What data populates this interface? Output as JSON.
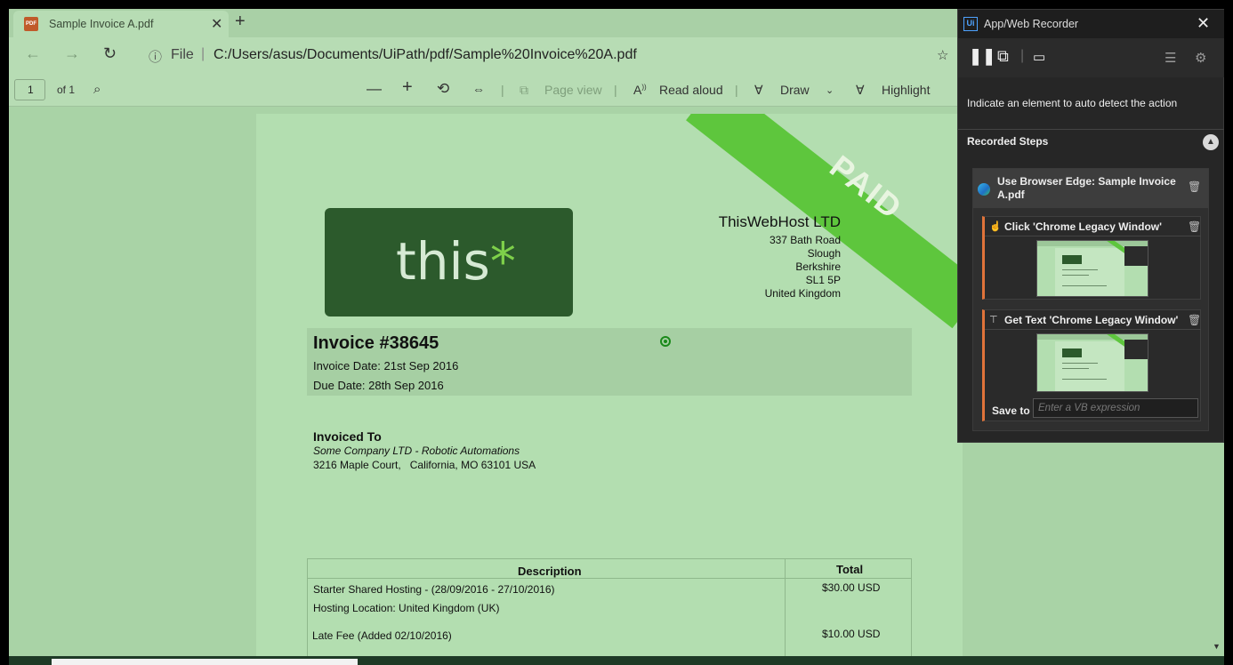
{
  "browser": {
    "tab_title": "Sample Invoice A.pdf",
    "tab_icon": "PDF",
    "file_label": "File",
    "url": "C:/Users/asus/Documents/UiPath/pdf/Sample%20Invoice%20A.pdf"
  },
  "pdf_toolbar": {
    "page_number": "1",
    "page_of": "of 1",
    "page_view": "Page view",
    "read_aloud": "Read aloud",
    "draw": "Draw",
    "highlight": "Highlight"
  },
  "invoice": {
    "paid_stamp": "PAID",
    "logo_text": "this",
    "logo_star": "*",
    "company": {
      "name": "ThisWebHost LTD",
      "line1": "337 Bath Road",
      "line2": "Slough",
      "line3": "Berkshire",
      "line4": "SL1 5P",
      "line5": "United Kingdom"
    },
    "number": "Invoice #38645",
    "invoice_date": "Invoice Date: 21st Sep 2016",
    "due_date": "Due Date: 28th Sep 2016",
    "invoiced_to": {
      "heading": "Invoiced To",
      "company": "Some Company LTD - Robotic Automations",
      "address": "3216 Maple Court,   California, MO 63101 USA"
    },
    "table": {
      "col_description": "Description",
      "col_total": "Total",
      "rows": [
        {
          "description": "Starter Shared Hosting - (28/09/2016 - 27/10/2016)",
          "total": "$30.00 USD"
        },
        {
          "description": "Hosting Location: United Kingdom (UK)",
          "total": ""
        },
        {
          "description": "Late Fee (Added 02/10/2016)",
          "total": "$10.00 USD"
        }
      ]
    }
  },
  "recorder": {
    "title": "App/Web Recorder",
    "hint": "Indicate an element to auto detect the action",
    "recorded_steps_label": "Recorded Steps",
    "steps": {
      "main_title": "Use Browser Edge: Sample Invoice A.pdf",
      "step1": "Click 'Chrome Legacy Window'",
      "step2": "Get Text 'Chrome Legacy Window'",
      "save_to_label": "Save to",
      "save_to_placeholder": "Enter a VB expression"
    }
  },
  "colors": {
    "paid_band": "#5ec63d",
    "recorder_bg": "#262626",
    "step_accent": "#e0733a",
    "page_tint": "#b3deb0"
  }
}
